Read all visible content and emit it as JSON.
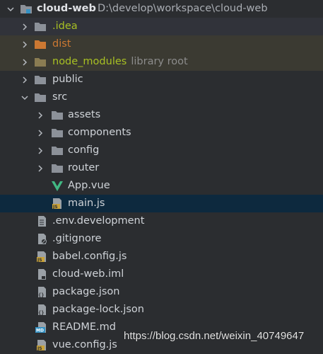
{
  "project": {
    "name": "cloud-web",
    "path": "D:\\develop\\workspace\\cloud-web"
  },
  "tree": {
    "idea": ".idea",
    "dist": "dist",
    "node_modules": "node_modules",
    "node_modules_hint": "library root",
    "public": "public",
    "src": "src",
    "assets": "assets",
    "components": "components",
    "config": "config",
    "router": "router",
    "app_vue": "App.vue",
    "main_js": "main.js",
    "env_development": ".env.development",
    "gitignore": ".gitignore",
    "babel_config": "babel.config.js",
    "cloud_web_iml": "cloud-web.iml",
    "package_json": "package.json",
    "package_lock": "package-lock.json",
    "readme": "README.md",
    "vue_config": "vue.config.js"
  },
  "watermark": "https://blog.csdn.net/weixin_40749647",
  "colors": {
    "background": "#2b2d30",
    "selected_row": "#0d293e",
    "excluded_row": "#3b3a32",
    "folder": "#8c9199",
    "excluded_text": "#cc7832",
    "library_text": "#a8c023",
    "vue_green": "#41b883"
  }
}
